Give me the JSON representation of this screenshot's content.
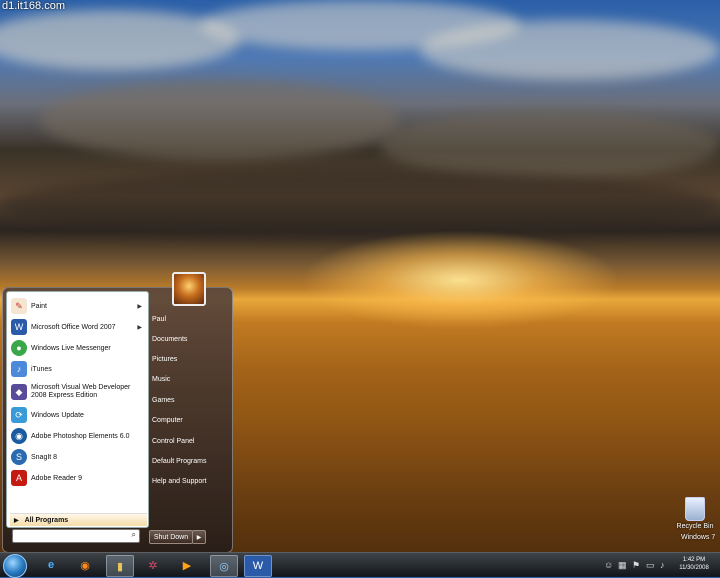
{
  "watermark": "d1.it168.com",
  "start_menu": {
    "programs": [
      {
        "label": "Paint",
        "has_submenu": true,
        "icon": "paint-icon"
      },
      {
        "label": "Microsoft Office Word 2007",
        "has_submenu": true,
        "icon": "word-icon"
      },
      {
        "label": "Windows Live Messenger",
        "has_submenu": false,
        "icon": "messenger-icon"
      },
      {
        "label": "iTunes",
        "has_submenu": false,
        "icon": "itunes-icon"
      },
      {
        "label": "Microsoft Visual Web Developer 2008 Express Edition",
        "has_submenu": false,
        "icon": "visual-web-developer-icon"
      },
      {
        "label": "Windows Update",
        "has_submenu": false,
        "icon": "windows-update-icon"
      },
      {
        "label": "Adobe Photoshop Elements 6.0",
        "has_submenu": false,
        "icon": "photoshop-elements-icon"
      },
      {
        "label": "SnagIt 8",
        "has_submenu": false,
        "icon": "snagit-icon"
      },
      {
        "label": "Adobe Reader 9",
        "has_submenu": false,
        "icon": "adobe-reader-icon"
      }
    ],
    "all_programs_label": "All Programs",
    "search_placeholder": "",
    "right_items": [
      "Paul",
      "Documents",
      "Pictures",
      "Music",
      "Games",
      "Computer",
      "Control Panel",
      "Default Programs",
      "Help and Support"
    ],
    "shutdown_label": "Shut Down"
  },
  "desktop": {
    "recycle_bin_label": "Recycle Bin",
    "os_label": "Windows 7"
  },
  "taskbar": {
    "pinned": [
      "internet-explorer-icon",
      "firefox-icon",
      "file-explorer-icon",
      "app-icon",
      "media-player-icon",
      "windows-live-icon",
      "word-icon"
    ],
    "clock_time": "1:42 PM",
    "clock_date": "11/30/2008"
  },
  "colors": {
    "accent": "#2b7dc4",
    "paint_red": "#c8302c",
    "word_blue": "#2a5aa8",
    "messenger_green": "#3aa84a",
    "reader_red": "#c41a12"
  }
}
